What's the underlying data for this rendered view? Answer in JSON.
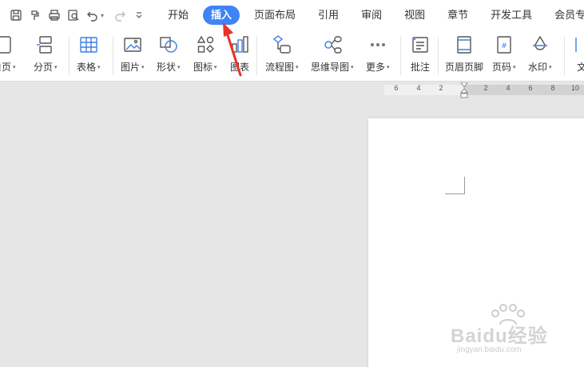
{
  "menubar": {
    "tabs": [
      {
        "label": "开始",
        "active": false
      },
      {
        "label": "插入",
        "active": true
      },
      {
        "label": "页面布局",
        "active": false
      },
      {
        "label": "引用",
        "active": false
      },
      {
        "label": "审阅",
        "active": false
      },
      {
        "label": "视图",
        "active": false
      },
      {
        "label": "章节",
        "active": false
      },
      {
        "label": "开发工具",
        "active": false
      },
      {
        "label": "会员专享",
        "active": false
      }
    ],
    "quick_access_icons": [
      "save-icon",
      "format-painter-icon",
      "print-icon",
      "print-preview-icon",
      "undo-icon",
      "redo-icon",
      "customize-icon"
    ]
  },
  "ribbon": {
    "items": [
      {
        "label": "白页",
        "icon": "blank-page-icon",
        "dropdown": true
      },
      {
        "label": "分页",
        "icon": "page-break-icon",
        "dropdown": true
      },
      {
        "label": "表格",
        "icon": "table-icon",
        "dropdown": true
      },
      {
        "label": "图片",
        "icon": "picture-icon",
        "dropdown": true
      },
      {
        "label": "形状",
        "icon": "shape-icon",
        "dropdown": true
      },
      {
        "label": "图标",
        "icon": "icons-icon",
        "dropdown": true
      },
      {
        "label": "图表",
        "icon": "chart-icon",
        "dropdown": false
      },
      {
        "label": "流程图",
        "icon": "flowchart-icon",
        "dropdown": true
      },
      {
        "label": "思维导图",
        "icon": "mindmap-icon",
        "dropdown": true
      },
      {
        "label": "更多",
        "icon": "more-icon",
        "dropdown": true
      },
      {
        "label": "批注",
        "icon": "comment-icon",
        "dropdown": false
      },
      {
        "label": "页眉页脚",
        "icon": "header-footer-icon",
        "dropdown": false
      },
      {
        "label": "页码",
        "icon": "page-number-icon",
        "dropdown": true
      },
      {
        "label": "水印",
        "icon": "watermark-icon",
        "dropdown": true
      },
      {
        "label": "文",
        "icon": "textbox-icon",
        "dropdown": false
      }
    ]
  },
  "ruler": {
    "left_numbers": [
      "6",
      "4",
      "2"
    ],
    "right_numbers": [
      "2",
      "4",
      "6",
      "8",
      "10"
    ]
  },
  "watermark": {
    "brand": "Baidu经验",
    "url": "jingyan.baidu.com"
  },
  "colors": {
    "accent": "#3f83f6",
    "annotation_arrow": "#e8322a",
    "icon_blue": "#3d7ee6"
  }
}
